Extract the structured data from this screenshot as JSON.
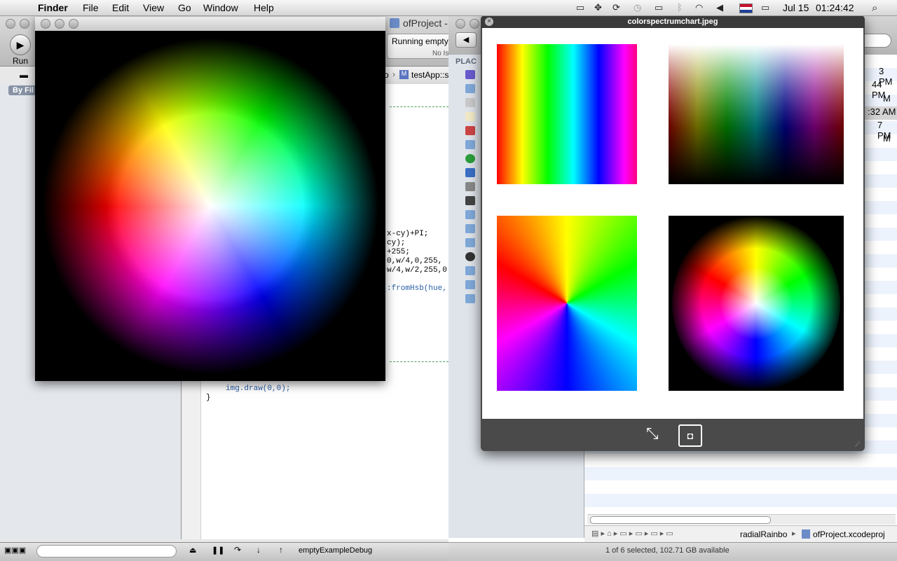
{
  "menubar": {
    "app": "Finder",
    "items": [
      "File",
      "Edit",
      "View",
      "Go",
      "Window",
      "Help"
    ],
    "date": "Jul 15",
    "time": "01:24:42"
  },
  "xcode": {
    "title": "ofProject -",
    "run_label": "Run",
    "status": "Running empty",
    "issues": "No Is",
    "breadcrumb_tail": "o",
    "breadcrumb_file": "testApp::s",
    "sidebar_filter": "By Fil",
    "scheme": "emptyExampleDebug",
    "code_lines": [
      "x-cy)+PI;",
      "cy);",
      "+255;",
      "0,w/4,0,255,",
      "w/4,w/2,255,0",
      ":fromHsb(hue,",
      "img.draw(0,0);",
      "}"
    ]
  },
  "finder": {
    "places_label": "PLAC",
    "list_times": [
      "3 PM",
      "44 PM",
      "M",
      ":32 AM",
      "7 PM",
      "M"
    ],
    "path": [
      "radialRainbo",
      "ofProject.xcodeproj"
    ],
    "status": "1 of 6 selected, 102.71 GB available"
  },
  "quicklook": {
    "filename": "colorspectrumchart.jpeg"
  }
}
